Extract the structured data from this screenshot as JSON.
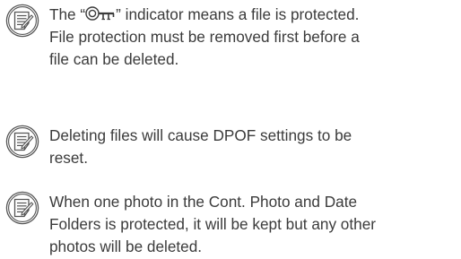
{
  "notes": [
    {
      "icon": "memo-note-icon",
      "lines": [
        {
          "before": "The “",
          "symbol": "protect-key-icon",
          "after": "” indicator means a file is protected."
        },
        "File protection must be removed first before a",
        "file can be deleted."
      ]
    },
    {
      "icon": "memo-note-icon",
      "lines": [
        "Deleting files will cause DPOF settings to be",
        "reset."
      ]
    },
    {
      "icon": "memo-note-icon",
      "lines": [
        "When one photo in the Cont. Photo and Date",
        "Folders is protected, it will be kept but any other",
        "photos will be deleted."
      ]
    }
  ],
  "colors": {
    "text": "#3b3b3b",
    "icon_stroke": "#555555"
  }
}
